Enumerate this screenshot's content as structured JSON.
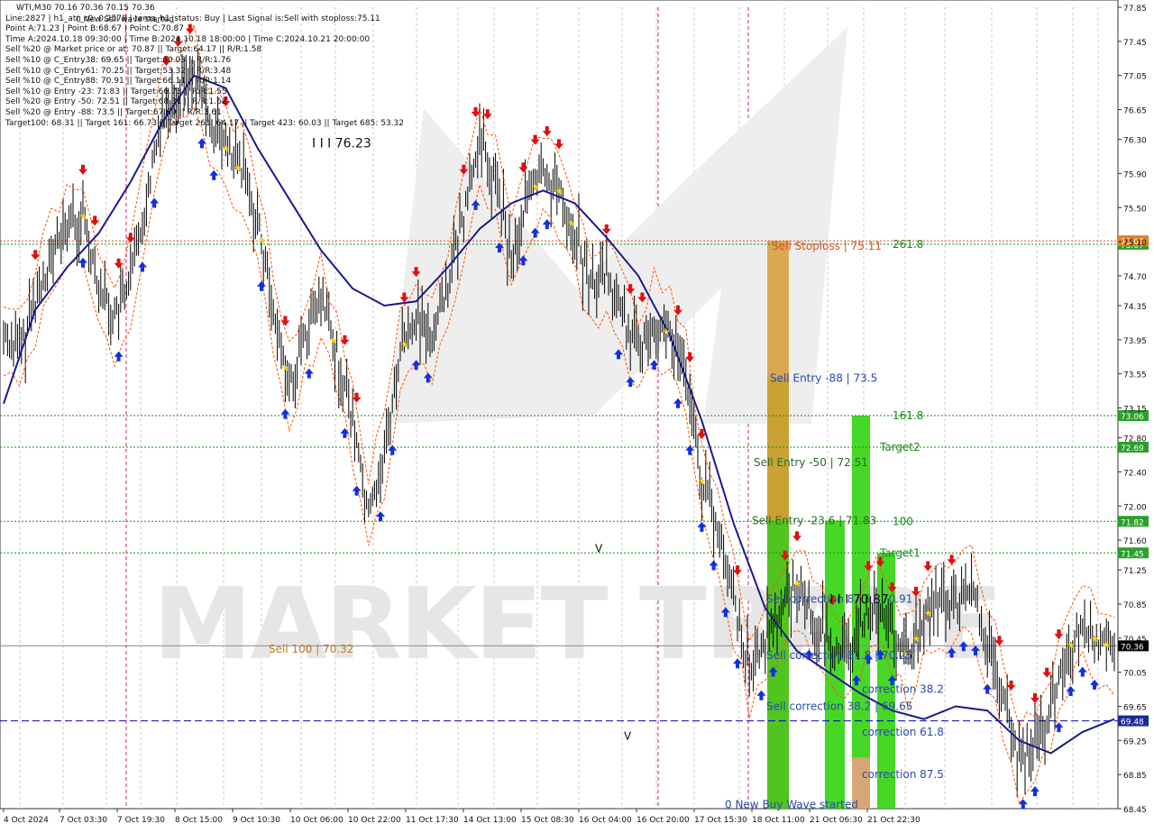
{
  "header": {
    "symbol_line": "WTI,M30   70.16 70.36 70.15 70.36",
    "lines": [
      "Line:2827  |  h1_atr_c0: 0.2578  |  tema_h1_status: Buy  |  Last Signal is:Sell with stoploss:75.11",
      "Point A:71.23 | Point B:68.67 | Point C:70.87",
      "Time A:2024.10.18 09:30:00 | Time B:2024.10.18 18:00:00 | Time C:2024.10.21 20:00:00",
      "Sell %20 @ Market price or at: 70.87 || Target:64.17 || R/R:1.58",
      "Sell %10 @ C_Entry38: 69.65 || Target:60.03 || R/R:1.76",
      "Sell %10 @ C_Entry61: 70.25 || Target:53.32 || R/R:3.48",
      "Sell %10 @ C_Entry88: 70.91 || Target:66.11 || R/R:1.14",
      "Sell %10 @ Entry -23: 71.83 || Target:66.73 || R/R:1.55",
      "Sell %20 @ Entry -50: 72.51 || Target:68.31 || R/R:1.62",
      "Sell %20 @ Entry -88: 73.5 || Target:67.69 || R/R:3.61",
      "Target100: 68.31 || Target 161: 66.73 || Target 261: 64.17 || Target 423: 60.03 || Target 685: 53.32"
    ],
    "overlay": "0 New Sell wave started"
  },
  "colors": {
    "candle": "#000000",
    "ma": "#1a1a8c",
    "envelope": "#ff5500",
    "sell_arrow": "#e01010",
    "buy_arrow": "#1030e0",
    "star": "#ffd800",
    "green_level": "#1a8a1a",
    "blue_level": "#0000cc",
    "red_level": "#e05020"
  },
  "chart_data": {
    "type": "candlestick",
    "symbol": "WTI",
    "timeframe": "M30",
    "ylim": [
      68.45,
      77.85
    ],
    "y_ticks": [
      "77.85",
      "77.45",
      "77.05",
      "76.65",
      "76.30",
      "75.90",
      "75.50",
      "75.10",
      "74.70",
      "74.35",
      "73.95",
      "73.55",
      "73.15",
      "72.80",
      "72.40",
      "72.00",
      "71.60",
      "71.25",
      "70.85",
      "70.45",
      "70.05",
      "69.65",
      "69.25",
      "68.85",
      "68.45"
    ],
    "x_ticks": [
      "4 Oct 2024",
      "7 Oct 03:30",
      "7 Oct 19:30",
      "8 Oct 15:00",
      "9 Oct 10:30",
      "10 Oct 06:00",
      "10 Oct 22:00",
      "11 Oct 17:30",
      "14 Oct 13:00",
      "15 Oct 08:30",
      "16 Oct 04:00",
      "16 Oct 20:00",
      "17 Oct 15:30",
      "18 Oct 11:00",
      "21 Oct 06:30",
      "21 Oct 22:30"
    ],
    "price_path": [
      [
        0,
        74.0
      ],
      [
        4,
        73.8
      ],
      [
        8,
        74.4
      ],
      [
        12,
        74.9
      ],
      [
        16,
        75.3
      ],
      [
        20,
        75.4
      ],
      [
        24,
        74.6
      ],
      [
        28,
        74.2
      ],
      [
        32,
        74.6
      ],
      [
        36,
        75.6
      ],
      [
        40,
        76.6
      ],
      [
        44,
        76.9
      ],
      [
        48,
        77.1
      ],
      [
        52,
        76.5
      ],
      [
        56,
        76.2
      ],
      [
        60,
        75.9
      ],
      [
        64,
        75.4
      ],
      [
        68,
        74.3
      ],
      [
        72,
        73.4
      ],
      [
        76,
        74.0
      ],
      [
        80,
        74.4
      ],
      [
        84,
        73.8
      ],
      [
        88,
        73.0
      ],
      [
        92,
        71.9
      ],
      [
        96,
        72.6
      ],
      [
        100,
        73.8
      ],
      [
        104,
        74.2
      ],
      [
        108,
        74.0
      ],
      [
        112,
        74.6
      ],
      [
        116,
        75.4
      ],
      [
        120,
        76.3
      ],
      [
        124,
        75.8
      ],
      [
        128,
        74.9
      ],
      [
        132,
        75.6
      ],
      [
        136,
        75.9
      ],
      [
        140,
        75.7
      ],
      [
        144,
        75.2
      ],
      [
        148,
        74.6
      ],
      [
        152,
        74.7
      ],
      [
        156,
        74.2
      ],
      [
        160,
        73.8
      ],
      [
        164,
        74.2
      ],
      [
        168,
        74.0
      ],
      [
        172,
        73.5
      ],
      [
        176,
        72.3
      ],
      [
        180,
        71.7
      ],
      [
        184,
        70.9
      ],
      [
        188,
        70.1
      ],
      [
        192,
        70.4
      ],
      [
        196,
        70.8
      ],
      [
        200,
        71.1
      ],
      [
        204,
        70.7
      ],
      [
        208,
        70.4
      ],
      [
        212,
        70.2
      ],
      [
        216,
        70.6
      ],
      [
        220,
        70.9
      ],
      [
        224,
        70.5
      ],
      [
        228,
        70.2
      ],
      [
        232,
        70.7
      ],
      [
        236,
        70.9
      ],
      [
        240,
        70.8
      ],
      [
        244,
        71.0
      ],
      [
        248,
        70.4
      ],
      [
        252,
        69.7
      ],
      [
        256,
        69.0
      ],
      [
        260,
        69.2
      ],
      [
        264,
        69.6
      ],
      [
        268,
        70.3
      ],
      [
        272,
        70.6
      ],
      [
        276,
        70.4
      ],
      [
        280,
        70.36
      ]
    ],
    "ma_path": [
      [
        0,
        73.2
      ],
      [
        8,
        74.3
      ],
      [
        16,
        74.8
      ],
      [
        24,
        75.2
      ],
      [
        32,
        75.8
      ],
      [
        40,
        76.5
      ],
      [
        48,
        77.05
      ],
      [
        56,
        76.9
      ],
      [
        64,
        76.2
      ],
      [
        72,
        75.6
      ],
      [
        80,
        75.0
      ],
      [
        88,
        74.55
      ],
      [
        96,
        74.35
      ],
      [
        104,
        74.4
      ],
      [
        112,
        74.8
      ],
      [
        120,
        75.25
      ],
      [
        128,
        75.55
      ],
      [
        136,
        75.7
      ],
      [
        144,
        75.55
      ],
      [
        152,
        75.15
      ],
      [
        160,
        74.7
      ],
      [
        168,
        74.0
      ],
      [
        176,
        73.0
      ],
      [
        184,
        71.8
      ],
      [
        192,
        70.8
      ],
      [
        200,
        70.3
      ],
      [
        208,
        70.05
      ],
      [
        216,
        69.8
      ],
      [
        224,
        69.6
      ],
      [
        232,
        69.5
      ],
      [
        240,
        69.65
      ],
      [
        248,
        69.6
      ],
      [
        256,
        69.25
      ],
      [
        264,
        69.1
      ],
      [
        272,
        69.35
      ],
      [
        280,
        69.5
      ]
    ],
    "levels": [
      {
        "label": "261.8",
        "value": 75.07,
        "badge": "75.07",
        "style": "green"
      },
      {
        "label": "161.8",
        "value": 73.06,
        "badge": "73.06",
        "style": "green"
      },
      {
        "label": "Target2",
        "value": 72.69,
        "badge": "72.69",
        "style": "green"
      },
      {
        "label": "100",
        "value": 71.82,
        "badge": "71.82",
        "style": "green"
      },
      {
        "label": "Target1",
        "value": 71.45,
        "badge": "71.45",
        "style": "green"
      },
      {
        "label": "",
        "value": 69.48,
        "badge": "69.48",
        "style": "blue"
      }
    ],
    "current_price": {
      "value": 70.36,
      "badge": "70.36"
    },
    "sell_stoploss": {
      "label": "Sell Stoploss | 75.11",
      "value": 75.11
    },
    "annotations": [
      {
        "text": "Sell Entry -88 | 73.5",
        "value": 73.5
      },
      {
        "text": "Sell Entry -50 | 72.51",
        "value": 72.51
      },
      {
        "text": "Sell Entry -23.6 | 71.83",
        "value": 71.83
      },
      {
        "text": "Sell correction 87.5 | 70.91",
        "value": 70.91
      },
      {
        "text": "Sell correction 61.8 | 70.25",
        "value": 70.25
      },
      {
        "text": "Sell correction 38.2 | 69.65",
        "value": 69.65
      },
      {
        "text": "Sell 100 | 70.32",
        "value": 70.32
      },
      {
        "text": "correction 38.2",
        "value": 69.85
      },
      {
        "text": "correction 61.8",
        "value": 69.35
      },
      {
        "text": "correction 87.5",
        "value": 68.85
      },
      {
        "text": "0 New Buy Wave started",
        "value": 68.5
      },
      {
        "text": "I I I 76.23",
        "value": 76.25
      },
      {
        "text": "I I I 70.87",
        "value": 70.9
      },
      {
        "text": "V",
        "value": 71.5
      },
      {
        "text": "V",
        "value": 69.3
      }
    ],
    "watermark": "MARKET TRADE"
  }
}
